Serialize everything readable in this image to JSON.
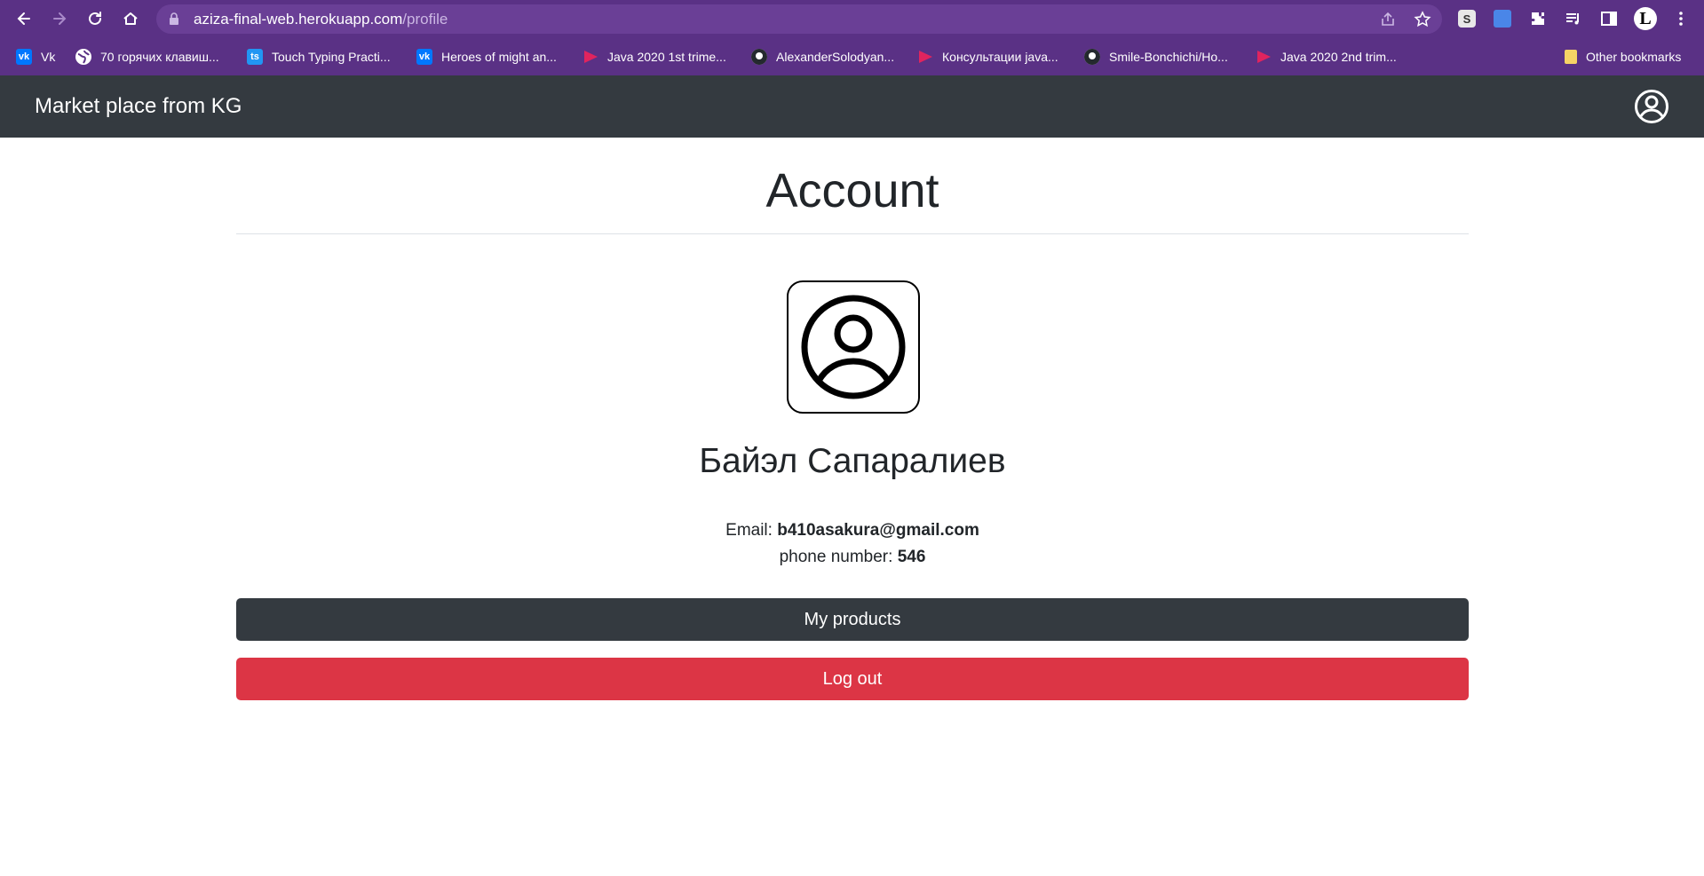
{
  "browser": {
    "url_host": "aziza-final-web.herokuapp.com",
    "url_path": "/profile",
    "bookmarks": [
      {
        "label": "Vk",
        "icon": "vk-icon"
      },
      {
        "label": "70 горячих клавиш...",
        "icon": "globe-icon"
      },
      {
        "label": "Touch Typing Practi...",
        "icon": "ts-icon"
      },
      {
        "label": "Heroes of might an...",
        "icon": "vk-icon"
      },
      {
        "label": "Java 2020 1st trime...",
        "icon": "play-icon"
      },
      {
        "label": "AlexanderSolodyan...",
        "icon": "github-icon"
      },
      {
        "label": "Консультации java...",
        "icon": "play-icon"
      },
      {
        "label": "Smile-Bonchichi/Ho...",
        "icon": "github-icon"
      },
      {
        "label": "Java 2020 2nd trim...",
        "icon": "play-icon"
      }
    ],
    "other_bookmarks": "Other bookmarks",
    "ts_badge": "ts",
    "s_badge": "S",
    "profile_letter": "L"
  },
  "navbar": {
    "brand": "Market place from KG"
  },
  "profile": {
    "title": "Account",
    "name": "Байэл Сапаралиев",
    "email_label": "Email:",
    "email": "b410asakura@gmail.com",
    "phone_label": "phone number:",
    "phone": "546"
  },
  "actions": {
    "my_products": "My products",
    "logout": "Log out"
  },
  "colors": {
    "chrome": "#5a3185",
    "navbar": "#343a40",
    "danger": "#dc3545"
  }
}
